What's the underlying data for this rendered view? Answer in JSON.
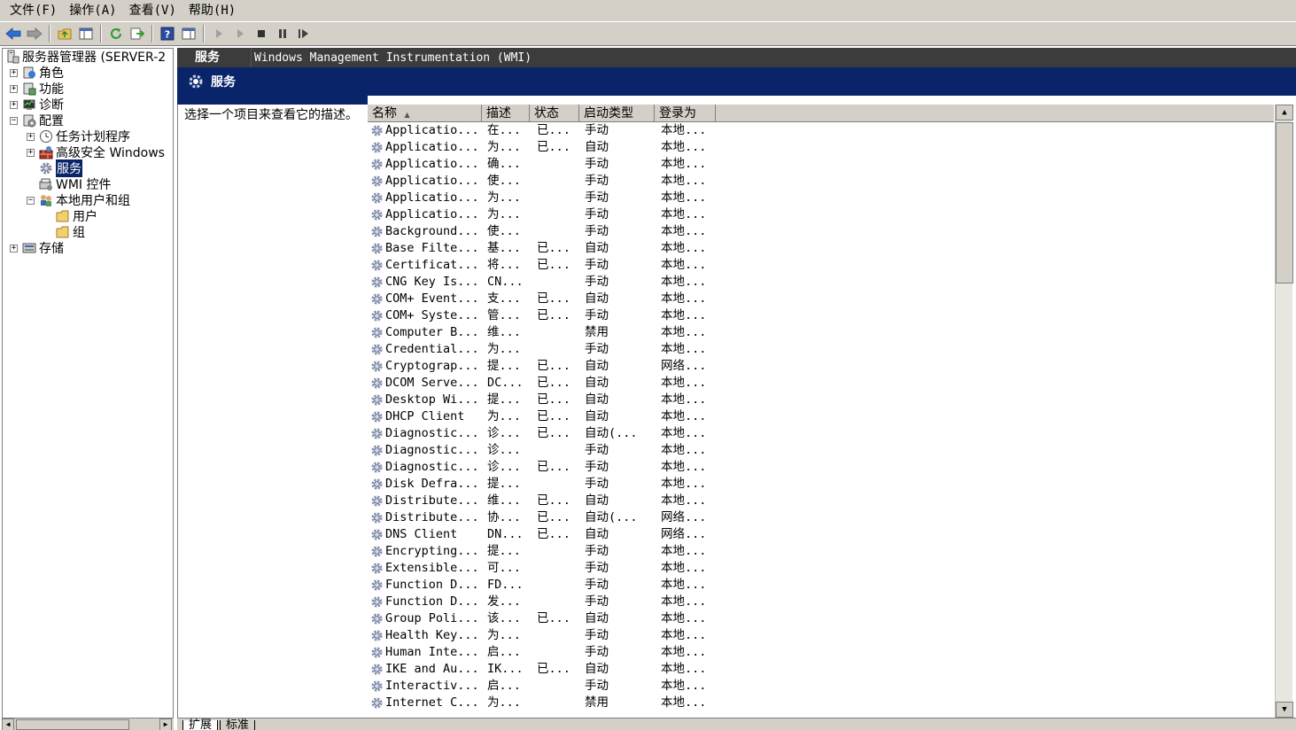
{
  "menu": [
    {
      "label": "文件(F)"
    },
    {
      "label": "操作(A)"
    },
    {
      "label": "查看(V)"
    },
    {
      "label": "帮助(H)"
    }
  ],
  "toolbar_icons": [
    "back-arrow-icon",
    "forward-arrow-icon",
    "up-folder-icon",
    "show-hide-tree-icon",
    "refresh-icon",
    "export-icon",
    "help-icon",
    "show-hide-action-icon",
    "start-icon",
    "start-alt-icon",
    "stop-icon",
    "pause-icon",
    "restart-icon"
  ],
  "tree": {
    "root": "服务器管理器 (SERVER-2",
    "roles": "角色",
    "features": "功能",
    "diagnostics": "诊断",
    "configuration": "配置",
    "task_scheduler": "任务计划程序",
    "firewall": "高级安全 Windows",
    "services": "服务",
    "wmi": "WMI 控件",
    "local_users": "本地用户和组",
    "users": "用户",
    "groups": "组",
    "storage": "存储"
  },
  "header": {
    "tab_title": "服务",
    "selected_service": "Windows Management Instrumentation (WMI)",
    "section_title": "服务"
  },
  "description": "选择一个项目来查看它的描述。",
  "columns": [
    "名称",
    "描述",
    "状态",
    "启动类型",
    "登录为"
  ],
  "services": [
    [
      "Applicatio...",
      "在...",
      "已...",
      "手动",
      "本地..."
    ],
    [
      "Applicatio...",
      "为...",
      "已...",
      "自动",
      "本地..."
    ],
    [
      "Applicatio...",
      "确...",
      "",
      "手动",
      "本地..."
    ],
    [
      "Applicatio...",
      "使...",
      "",
      "手动",
      "本地..."
    ],
    [
      "Applicatio...",
      "为...",
      "",
      "手动",
      "本地..."
    ],
    [
      "Applicatio...",
      "为...",
      "",
      "手动",
      "本地..."
    ],
    [
      "Background...",
      "使...",
      "",
      "手动",
      "本地..."
    ],
    [
      "Base Filte...",
      "基...",
      "已...",
      "自动",
      "本地..."
    ],
    [
      "Certificat...",
      "将...",
      "已...",
      "手动",
      "本地..."
    ],
    [
      "CNG Key Is...",
      "CN...",
      "",
      "手动",
      "本地..."
    ],
    [
      "COM+ Event...",
      "支...",
      "已...",
      "自动",
      "本地..."
    ],
    [
      "COM+ Syste...",
      "管...",
      "已...",
      "手动",
      "本地..."
    ],
    [
      "Computer B...",
      "维...",
      "",
      "禁用",
      "本地..."
    ],
    [
      "Credential...",
      "为...",
      "",
      "手动",
      "本地..."
    ],
    [
      "Cryptograp...",
      "提...",
      "已...",
      "自动",
      "网络..."
    ],
    [
      "DCOM Serve...",
      "DC...",
      "已...",
      "自动",
      "本地..."
    ],
    [
      "Desktop Wi...",
      "提...",
      "已...",
      "自动",
      "本地..."
    ],
    [
      "DHCP Client",
      "为...",
      "已...",
      "自动",
      "本地..."
    ],
    [
      "Diagnostic...",
      "诊...",
      "已...",
      "自动(...",
      "本地..."
    ],
    [
      "Diagnostic...",
      "诊...",
      "",
      "手动",
      "本地..."
    ],
    [
      "Diagnostic...",
      "诊...",
      "已...",
      "手动",
      "本地..."
    ],
    [
      "Disk Defra...",
      "提...",
      "",
      "手动",
      "本地..."
    ],
    [
      "Distribute...",
      "维...",
      "已...",
      "自动",
      "本地..."
    ],
    [
      "Distribute...",
      "协...",
      "已...",
      "自动(...",
      "网络..."
    ],
    [
      "DNS Client",
      "DN...",
      "已...",
      "自动",
      "网络..."
    ],
    [
      "Encrypting...",
      "提...",
      "",
      "手动",
      "本地..."
    ],
    [
      "Extensible...",
      "可...",
      "",
      "手动",
      "本地..."
    ],
    [
      "Function D...",
      "FD...",
      "",
      "手动",
      "本地..."
    ],
    [
      "Function D...",
      "发...",
      "",
      "手动",
      "本地..."
    ],
    [
      "Group Poli...",
      "该...",
      "已...",
      "自动",
      "本地..."
    ],
    [
      "Health Key...",
      "为...",
      "",
      "手动",
      "本地..."
    ],
    [
      "Human Inte...",
      "启...",
      "",
      "手动",
      "本地..."
    ],
    [
      "IKE and Au...",
      "IK...",
      "已...",
      "自动",
      "本地..."
    ],
    [
      "Interactiv...",
      "启...",
      "",
      "手动",
      "本地..."
    ],
    [
      "Internet C...",
      "为...",
      "",
      "禁用",
      "本地..."
    ]
  ],
  "bottom_tabs": [
    "扩展",
    "标准"
  ]
}
